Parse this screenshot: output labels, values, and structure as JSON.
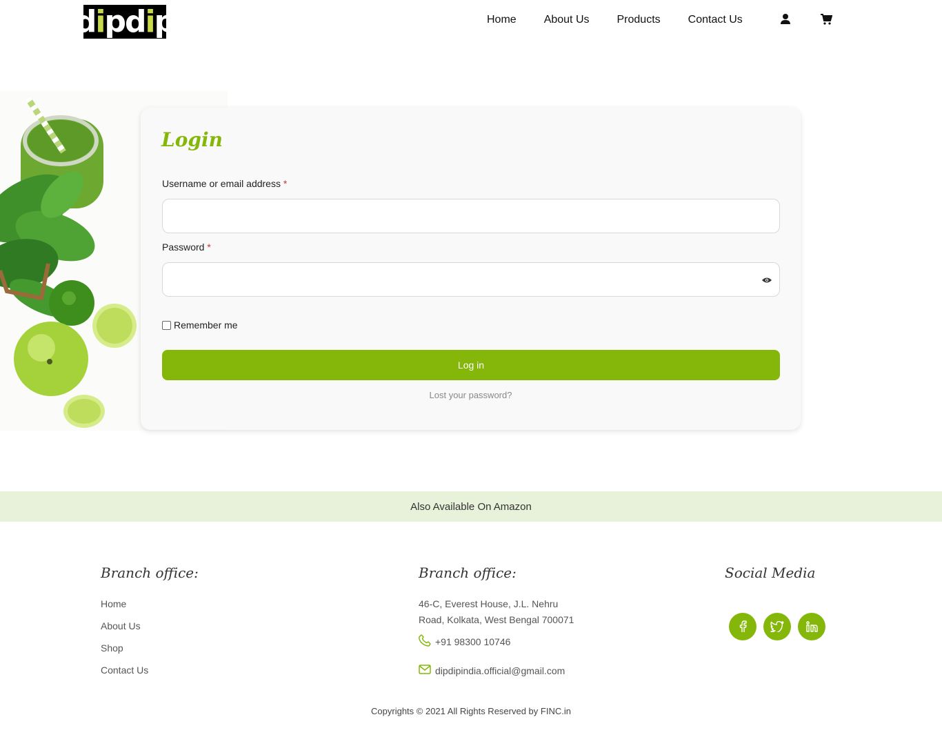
{
  "header": {
    "logo_text": "dipdip",
    "nav": [
      "Home",
      "About Us",
      "Products",
      "Contact Us"
    ],
    "icons": [
      "user-icon",
      "cart-icon"
    ]
  },
  "login": {
    "title": "Login",
    "username_label": "Username or email address",
    "password_label": "Password",
    "required_mark": "*",
    "remember_label": "Remember me",
    "login_button": "Log in",
    "lost_password": "Lost your password?"
  },
  "amazon_banner": "Also Available On Amazon",
  "footer": {
    "col1": {
      "heading": "Branch office:",
      "links": [
        "Home",
        "About Us",
        "Shop",
        "Contact Us"
      ]
    },
    "col2": {
      "heading": "Branch office:",
      "address_line1": "46-C, Everest House, J.L. Nehru",
      "address_line2": "Road, Kolkata, West Bengal 700071",
      "phone": "+91 98300 10746",
      "email": "dipdipindia.official@gmail.com"
    },
    "col3": {
      "heading": "Social Media",
      "icons": [
        "facebook-icon",
        "twitter-icon",
        "linkedin-icon"
      ]
    },
    "copyright": "Copyrights © 2021 All Rights Reserved by FINC.in"
  },
  "colors": {
    "accent": "#84b709",
    "banner_bg": "#e8f1da"
  }
}
